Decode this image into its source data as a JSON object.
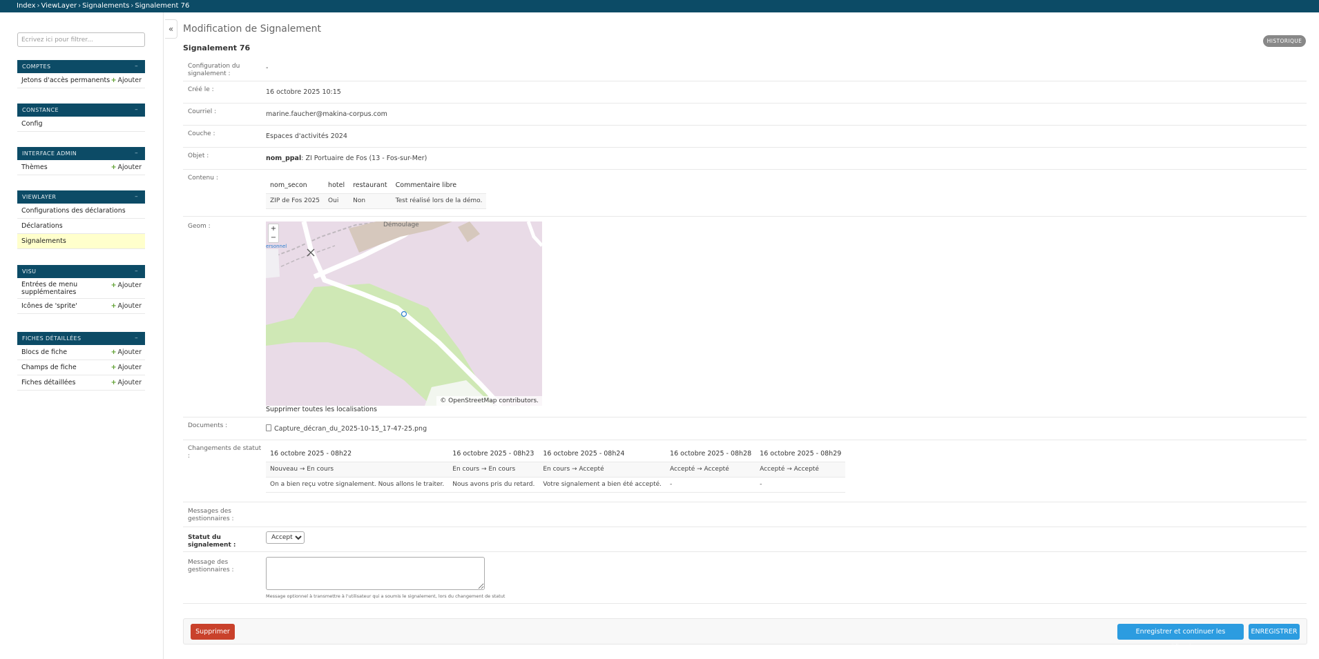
{
  "breadcrumbs": [
    "Index",
    "ViewLayer",
    "Signalements",
    "Signalement 76"
  ],
  "breadcrumb_separator": "›",
  "sidebar": {
    "filter_placeholder": "Écrivez ici pour filtrer...",
    "toggle_glyph": "–",
    "add_label": "Ajouter",
    "modules": [
      {
        "title": "COMPTES",
        "items": [
          {
            "label": "Jetons d'accès permanents"
          }
        ]
      },
      {
        "title": "CONSTANCE",
        "items": [
          {
            "label": "Config"
          }
        ]
      },
      {
        "title": "INTERFACE ADMIN",
        "items": [
          {
            "label": "Thèmes"
          }
        ]
      },
      {
        "title": "VIEWLAYER",
        "items": [
          {
            "label": "Configurations des déclarations"
          },
          {
            "label": "Déclarations"
          },
          {
            "label": "Signalements"
          }
        ]
      },
      {
        "title": "VISU",
        "items": [
          {
            "label": "Entrées de menu supplémentaires"
          },
          {
            "label": "Icônes de 'sprite'"
          }
        ]
      },
      {
        "title": "FICHES DÉTAILLÉES",
        "items": [
          {
            "label": "Blocs de fiche"
          },
          {
            "label": "Champs de fiche"
          },
          {
            "label": "Fiches détaillées"
          }
        ]
      }
    ]
  },
  "collapse_glyph": "«",
  "header": {
    "page_title": "Modification de Signalement",
    "object_title": "Signalement 76",
    "history_label": "HISTORIQUE"
  },
  "fields": {
    "config": {
      "label": "Configuration du signalement :",
      "value": "-"
    },
    "created": {
      "label": "Créé le :",
      "value": "16 octobre 2025 10:15"
    },
    "email": {
      "label": "Courriel :",
      "value": "marine.faucher@makina-corpus.com"
    },
    "layer": {
      "label": "Couche :",
      "value": "Espaces d'activités 2024"
    },
    "object": {
      "label": "Objet :",
      "key": "nom_ppal",
      "value": ": ZI Portuaire de Fos (13 - Fos-sur-Mer)"
    },
    "content": {
      "label": "Contenu :",
      "headers": [
        "nom_secon",
        "hotel",
        "restaurant",
        "Commentaire libre"
      ],
      "row": [
        "ZIP de Fos 2025",
        "Oui",
        "Non",
        "Test réalisé lors de la démo."
      ]
    },
    "geom": {
      "label": "Geom :",
      "zoom_in": "+",
      "zoom_out": "−",
      "map_place_label": "Démoulage",
      "map_fragment_label": "ersonnel",
      "attribution_prefix": "©",
      "attribution_link": "OpenStreetMap",
      "attribution_suffix": "contributors.",
      "clear_label": "Supprimer toutes les localisations",
      "colors": {
        "land": "#e9dbe7",
        "green": "#cfe8b5",
        "road": "#ffffff",
        "building": "#d6c8bd",
        "marker": "#2c7fd0"
      }
    },
    "documents": {
      "label": "Documents :",
      "file": "Capture_décran_du_2025-10-15_17-47-25.png"
    },
    "status_changes": {
      "label": "Changements de statut :",
      "dates": [
        "16 octobre 2025 - 08h22",
        "16 octobre 2025 - 08h23",
        "16 octobre 2025 - 08h24",
        "16 octobre 2025 - 08h28",
        "16 octobre 2025 - 08h29"
      ],
      "transitions": [
        "Nouveau → En cours",
        "En cours → En cours",
        "En cours → Accepté",
        "Accepté → Accepté",
        "Accepté → Accepté"
      ],
      "messages": [
        "On a bien reçu votre signalement. Nous allons le traiter.",
        "Nous avons pris du retard.",
        "Votre signalement a bien été accepté.",
        "-",
        "-"
      ]
    },
    "manager_messages": {
      "label": "Messages des gestionnaires :"
    },
    "status": {
      "label": "Statut du signalement :",
      "value": "Accepté"
    },
    "manager_message": {
      "label": "Message des gestionnaires :",
      "value": "",
      "help": "Message optionnel à transmettre à l'utilisateur qui a soumis le signalement, lors du changement de statut"
    }
  },
  "actions": {
    "delete": "Supprimer",
    "save_continue": "Enregistrer et continuer les modifications",
    "save": "ENREGISTRER"
  },
  "colors": {
    "header_bg": "#0c4b66",
    "delete": "#c9412b",
    "primary": "#2c9ce0",
    "active_row": "#ffffcc"
  }
}
